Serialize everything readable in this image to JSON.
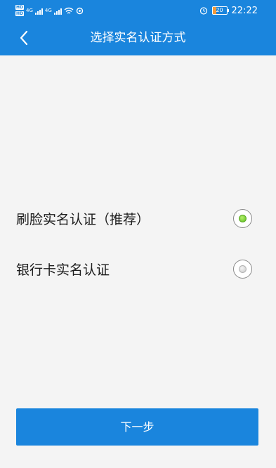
{
  "status_bar": {
    "hd_top": "HD",
    "hd_bottom": "HD",
    "net1": "4G",
    "net2": "4G",
    "battery": "20",
    "time": "22:22",
    "icons": [
      "alarm-icon",
      "wifi-icon",
      "sync-icon",
      "signal-icon"
    ]
  },
  "header": {
    "title": "选择实名认证方式",
    "back_icon": "chevron-left-icon",
    "background": "#1a85dd"
  },
  "options": [
    {
      "label": "刷脸实名认证（推荐）",
      "selected": true
    },
    {
      "label": "银行卡实名认证",
      "selected": false
    }
  ],
  "footer": {
    "next_label": "下一步"
  },
  "colors": {
    "accent": "#1a85dd",
    "radio_selected": "#5bbf1e",
    "background": "#f4f4f4"
  }
}
